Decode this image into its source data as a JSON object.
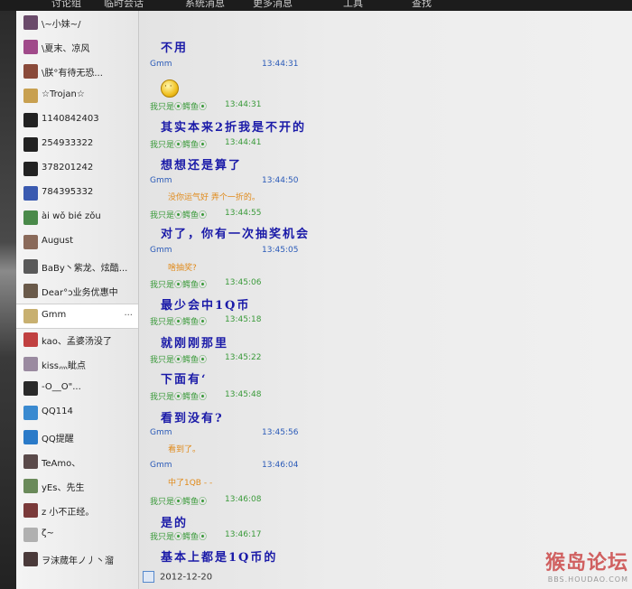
{
  "top_tabs": [
    "讨论组",
    "临时会话",
    "系统消息",
    "更多消息",
    "工具",
    "查找"
  ],
  "contacts": [
    {
      "name": "\\~小妹~/",
      "color": "#6a4a6a"
    },
    {
      "name": "\\夏末、凉风",
      "color": "#a04a8a"
    },
    {
      "name": "\\朕°有待无恐...",
      "color": "#8a4a3a"
    },
    {
      "name": "☆Trojan☆",
      "color": "#c8a050"
    },
    {
      "name": "1140842403",
      "color": "#222222"
    },
    {
      "name": "254933322",
      "color": "#222222"
    },
    {
      "name": "378201242",
      "color": "#222222"
    },
    {
      "name": "784395332",
      "color": "#3a5ab0"
    },
    {
      "name": "ài wǒ bié zǒu",
      "color": "#4a8a4a"
    },
    {
      "name": "August",
      "color": "#8a6a5a"
    },
    {
      "name": "BaBy丶紫龙、炫酷...",
      "color": "#5a5a5a"
    },
    {
      "name": "Dear°ɔ业务优惠中",
      "color": "#6a5a4a"
    },
    {
      "name": "Gmm",
      "color": "#c8b070",
      "selected": true,
      "more": "..."
    },
    {
      "name": "kao、孟婆汤没了",
      "color": "#c04040"
    },
    {
      "name": "kiss灬眦点",
      "color": "#9a8aa0"
    },
    {
      "name": "-O__O\"...",
      "color": "#2a2a2a"
    },
    {
      "name": "QQ114",
      "color": "#3a8ad0"
    },
    {
      "name": "QQ提醒",
      "color": "#2a7ac8"
    },
    {
      "name": "TeAmo、",
      "color": "#5a4a4a"
    },
    {
      "name": "yEs、先生",
      "color": "#6a8a5a"
    },
    {
      "name": "z 小不正经。",
      "color": "#7a3a3a"
    },
    {
      "name": "ζ~",
      "color": "#b0b0b0"
    },
    {
      "name": "ヲ沫蒇年ノ丿丶溜",
      "color": "#4a3a3a"
    }
  ],
  "chat_items": [
    {
      "type": "msg",
      "text": "不用"
    },
    {
      "type": "hdr",
      "who": "gmm",
      "name": "Gmm",
      "time": "13:44:31"
    },
    {
      "type": "emoji",
      "name": "smiley-emoticon"
    },
    {
      "type": "hdr",
      "who": "me",
      "name": "我只是⦿鳄鱼⦿",
      "time": "13:44:31"
    },
    {
      "type": "msg",
      "text": "其实本来2折我是不开的"
    },
    {
      "type": "hdr",
      "who": "me",
      "name": "我只是⦿鳄鱼⦿",
      "time": "13:44:41"
    },
    {
      "type": "msg",
      "text": "想想还是算了"
    },
    {
      "type": "hdr",
      "who": "gmm",
      "name": "Gmm",
      "time": "13:44:50"
    },
    {
      "type": "reply",
      "text": "没你运气好 弄个一折的。"
    },
    {
      "type": "hdr",
      "who": "me",
      "name": "我只是⦿鳄鱼⦿",
      "time": "13:44:55"
    },
    {
      "type": "msg",
      "text": "对了，你有一次抽奖机会"
    },
    {
      "type": "hdr",
      "who": "gmm",
      "name": "Gmm",
      "time": "13:45:05"
    },
    {
      "type": "reply",
      "text": "啥抽奖?"
    },
    {
      "type": "hdr",
      "who": "me",
      "name": "我只是⦿鳄鱼⦿",
      "time": "13:45:06"
    },
    {
      "type": "msg",
      "text": "最少会中1Q币"
    },
    {
      "type": "hdr",
      "who": "me",
      "name": "我只是⦿鳄鱼⦿",
      "time": "13:45:18"
    },
    {
      "type": "msg",
      "text": "就刚刚那里"
    },
    {
      "type": "hdr",
      "who": "me",
      "name": "我只是⦿鳄鱼⦿",
      "time": "13:45:22"
    },
    {
      "type": "msg",
      "text": "下面有‘"
    },
    {
      "type": "hdr",
      "who": "me",
      "name": "我只是⦿鳄鱼⦿",
      "time": "13:45:48"
    },
    {
      "type": "msg",
      "text": "看到没有?"
    },
    {
      "type": "hdr",
      "who": "gmm",
      "name": "Gmm",
      "time": "13:45:56"
    },
    {
      "type": "reply",
      "text": "看到了。"
    },
    {
      "type": "hdr",
      "who": "gmm",
      "name": "Gmm",
      "time": "13:46:04"
    },
    {
      "type": "reply",
      "text": "中了1QB  - -"
    },
    {
      "type": "hdr",
      "who": "me",
      "name": "我只是⦿鳄鱼⦿",
      "time": "13:46:08"
    },
    {
      "type": "msg",
      "text": "是的"
    },
    {
      "type": "hdr",
      "who": "me",
      "name": "我只是⦿鳄鱼⦿",
      "time": "13:46:17"
    },
    {
      "type": "msg",
      "text": "基本上都是1Q币的"
    }
  ],
  "date_label": "2012-12-20",
  "watermark": {
    "text": "猴岛论坛",
    "url": "BBS.HOUDAO.COM"
  }
}
